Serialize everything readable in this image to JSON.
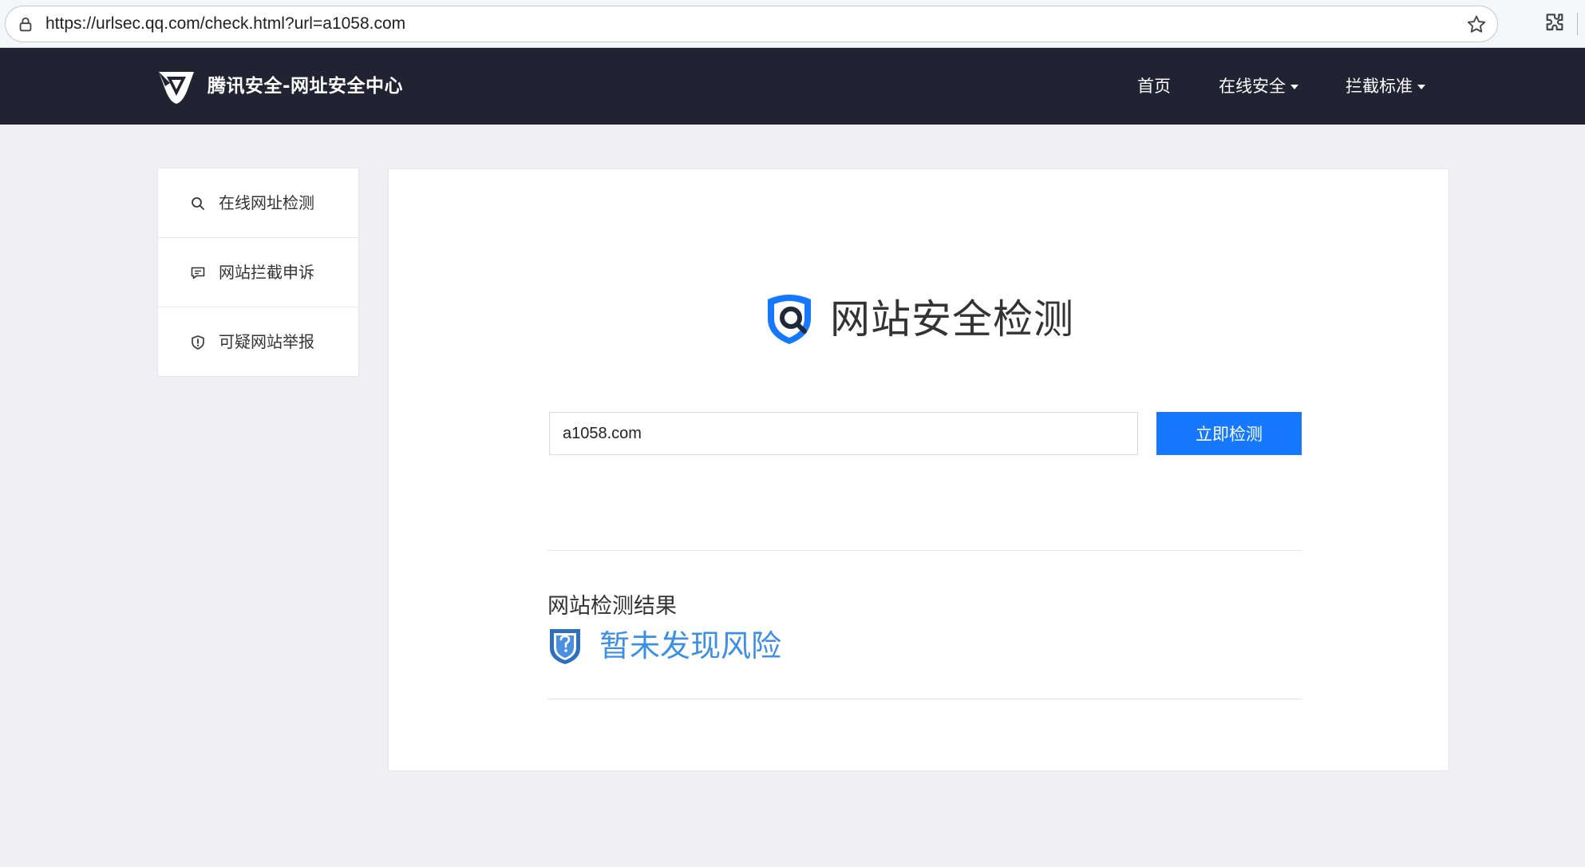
{
  "browser": {
    "url": "https://urlsec.qq.com/check.html?url=a1058.com"
  },
  "header": {
    "site_title": "腾讯安全-网址安全中心",
    "nav": [
      {
        "label": "首页",
        "has_dropdown": false
      },
      {
        "label": "在线安全",
        "has_dropdown": true
      },
      {
        "label": "拦截标准",
        "has_dropdown": true
      }
    ]
  },
  "sidebar": {
    "items": [
      {
        "label": "在线网址检测",
        "icon": "search-icon"
      },
      {
        "label": "网站拦截申诉",
        "icon": "message-icon"
      },
      {
        "label": "可疑网站举报",
        "icon": "shield-alert-icon"
      }
    ]
  },
  "main": {
    "title": "网站安全检测",
    "input_value": "a1058.com",
    "check_button_label": "立即检测",
    "result_heading": "网站检测结果",
    "result_status": "暂未发现风险"
  },
  "colors": {
    "header_bg": "#212232",
    "accent": "#1677ff",
    "status_text": "#3d8fe6",
    "page_bg": "#f0f0f4"
  }
}
